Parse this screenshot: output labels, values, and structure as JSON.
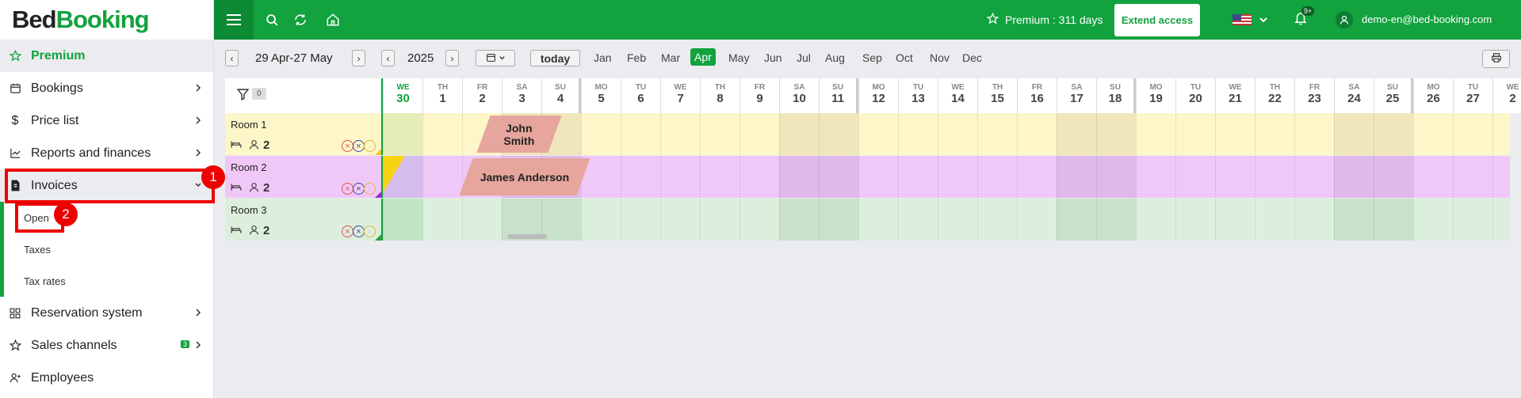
{
  "logo": {
    "part1": "Bed",
    "part2": "Booking"
  },
  "sidebar": {
    "premium": "Premium",
    "bookings": "Bookings",
    "price_list": "Price list",
    "reports": "Reports and finances",
    "invoices": "Invoices",
    "invoices_sub": [
      "Open",
      "Taxes",
      "Tax rates"
    ],
    "reservation_system": "Reservation system",
    "sales_channels": "Sales channels",
    "sales_channels_badge": "3",
    "employees": "Employees"
  },
  "annotations": {
    "n1": "1",
    "n2": "2"
  },
  "topbar": {
    "premium_days": "Premium : 311 days",
    "extend": "Extend access",
    "notif_count": "9+",
    "email": "demo-en@bed-booking.com"
  },
  "toolbar": {
    "range": "29 Apr-27 May",
    "year": "2025",
    "today": "today",
    "months": [
      "Jan",
      "Feb",
      "Mar",
      "Apr",
      "May",
      "Jun",
      "Jul",
      "Aug",
      "Sep",
      "Oct",
      "Nov",
      "Dec"
    ],
    "active_month": "Apr"
  },
  "grid": {
    "filter_count": "0",
    "days": [
      {
        "dw": "WE",
        "dn": "30",
        "current": true
      },
      {
        "dw": "TH",
        "dn": "1"
      },
      {
        "dw": "FR",
        "dn": "2"
      },
      {
        "dw": "SA",
        "dn": "3",
        "weekend": true
      },
      {
        "dw": "SU",
        "dn": "4",
        "weekend": true,
        "week_end": true
      },
      {
        "dw": "MO",
        "dn": "5"
      },
      {
        "dw": "TU",
        "dn": "6"
      },
      {
        "dw": "WE",
        "dn": "7"
      },
      {
        "dw": "TH",
        "dn": "8"
      },
      {
        "dw": "FR",
        "dn": "9"
      },
      {
        "dw": "SA",
        "dn": "10",
        "weekend": true
      },
      {
        "dw": "SU",
        "dn": "11",
        "weekend": true,
        "week_end": true
      },
      {
        "dw": "MO",
        "dn": "12"
      },
      {
        "dw": "TU",
        "dn": "13"
      },
      {
        "dw": "WE",
        "dn": "14"
      },
      {
        "dw": "TH",
        "dn": "15"
      },
      {
        "dw": "FR",
        "dn": "16"
      },
      {
        "dw": "SA",
        "dn": "17",
        "weekend": true
      },
      {
        "dw": "SU",
        "dn": "18",
        "weekend": true,
        "week_end": true
      },
      {
        "dw": "MO",
        "dn": "19"
      },
      {
        "dw": "TU",
        "dn": "20"
      },
      {
        "dw": "WE",
        "dn": "21"
      },
      {
        "dw": "TH",
        "dn": "22"
      },
      {
        "dw": "FR",
        "dn": "23"
      },
      {
        "dw": "SA",
        "dn": "24",
        "weekend": true
      },
      {
        "dw": "SU",
        "dn": "25",
        "weekend": true,
        "week_end": true
      },
      {
        "dw": "MO",
        "dn": "26"
      },
      {
        "dw": "TU",
        "dn": "27"
      },
      {
        "dw": "WE",
        "dn": "2"
      }
    ],
    "rooms": [
      {
        "name": "Room 1",
        "guests": "2",
        "color": "#fdf6c8",
        "weekend_color": "#efe6bb",
        "today_color": "#e6ecb8"
      },
      {
        "name": "Room 2",
        "guests": "2",
        "color": "#f0c8f8",
        "weekend_color": "#e0b8ea",
        "today_color": "#d5bcee"
      },
      {
        "name": "Room 3",
        "guests": "2",
        "color": "#dcefdc",
        "weekend_color": "#c9e1ca",
        "today_color": "#bfe5c4"
      }
    ],
    "bookings": [
      {
        "guest": "John Smith",
        "room": 0
      },
      {
        "guest": "James Anderson",
        "room": 1
      }
    ]
  }
}
